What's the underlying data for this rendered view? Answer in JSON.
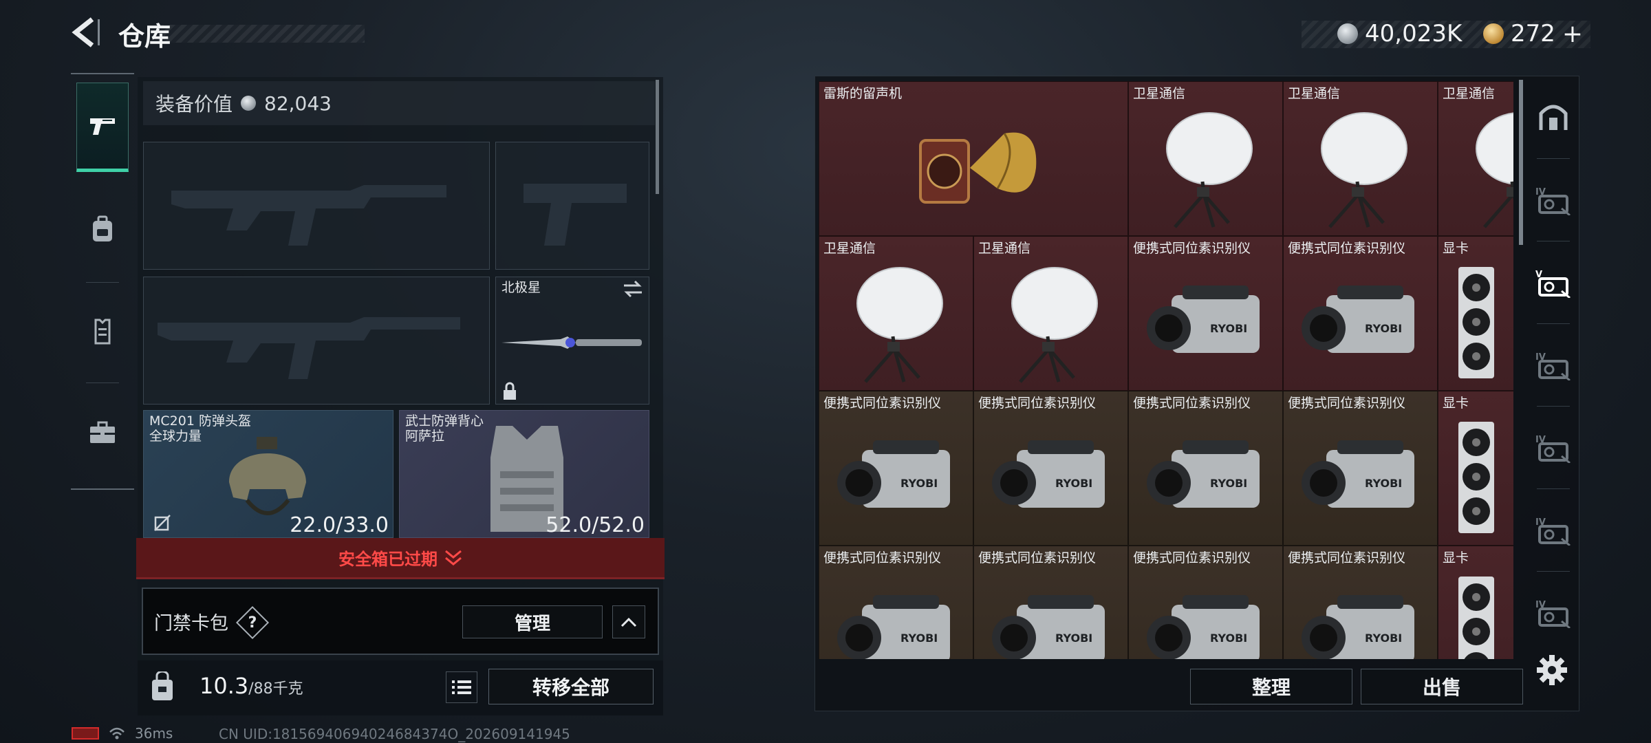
{
  "header": {
    "title": "仓库",
    "currency_silver": "40,023K",
    "currency_gold": "272",
    "currency_gold_plus": "+"
  },
  "left_tabs": [
    {
      "icon": "pistol-icon",
      "active": true
    },
    {
      "icon": "backpack-icon",
      "active": false
    },
    {
      "icon": "clipboard-icon",
      "active": false
    },
    {
      "icon": "toolbox-icon",
      "active": false
    }
  ],
  "equipment": {
    "value_label": "装备价值",
    "value": "82,043",
    "melee_name": "北极星",
    "helmet_name": "MC201 防弹头盔",
    "helmet_brand": "全球力量",
    "helmet_durability": "22.0/33.0",
    "vest_name": "武士防弹背心",
    "vest_brand": "阿萨拉",
    "vest_durability": "52.0/52.0"
  },
  "safe_box": {
    "expired_text": "安全箱已过期"
  },
  "keycard": {
    "label": "门禁卡包",
    "help": "?",
    "manage_label": "管理"
  },
  "bottom": {
    "weight_current": "10.3",
    "weight_max": "/88千克",
    "transfer_all_label": "转移全部"
  },
  "status": {
    "ping": "36ms",
    "uid": "CN UID:18156940694024684374O_202609141945"
  },
  "stash": {
    "cells": [
      {
        "label": "雷斯的留声机",
        "item": "gramophone",
        "bg": "red"
      },
      {
        "label": "卫星通信",
        "item": "satellite",
        "bg": "red"
      },
      {
        "label": "卫星通信",
        "item": "satellite",
        "bg": "red"
      },
      {
        "label": "卫星通信",
        "item": "satellite",
        "bg": "red"
      },
      {
        "label": "卫星通信",
        "item": "satellite",
        "bg": "red"
      },
      {
        "label": "卫星通信",
        "item": "satellite",
        "bg": "red"
      },
      {
        "label": "便携式同位素识别仪",
        "item": "isotope",
        "bg": "red"
      },
      {
        "label": "便携式同位素识别仪",
        "item": "isotope",
        "bg": "red"
      },
      {
        "label": "显卡",
        "item": "gpu",
        "bg": "red"
      },
      {
        "label": "便携式同位素识别仪",
        "item": "isotope",
        "bg": "brown"
      },
      {
        "label": "便携式同位素识别仪",
        "item": "isotope",
        "bg": "brown"
      },
      {
        "label": "便携式同位素识别仪",
        "item": "isotope",
        "bg": "brown"
      },
      {
        "label": "便携式同位素识别仪",
        "item": "isotope",
        "bg": "brown"
      },
      {
        "label": "显卡",
        "item": "gpu",
        "bg": "red"
      },
      {
        "label": "便携式同位素识别仪",
        "item": "isotope",
        "bg": "brown"
      },
      {
        "label": "便携式同位素识别仪",
        "item": "isotope",
        "bg": "brown"
      },
      {
        "label": "便携式同位素识别仪",
        "item": "isotope",
        "bg": "brown"
      },
      {
        "label": "便携式同位素识别仪",
        "item": "isotope",
        "bg": "brown"
      },
      {
        "label": "显卡",
        "item": "gpu",
        "bg": "red"
      }
    ],
    "tidy_label": "整理",
    "sell_label": "出售",
    "isotope_brand": "RYOBI"
  },
  "right_tabs": [
    {
      "icon": "vault-icon"
    },
    {
      "icon": "storage-iv-icon",
      "tag": "IV"
    },
    {
      "icon": "storage-v-icon",
      "tag": "V",
      "active": true
    },
    {
      "icon": "storage-iv-icon",
      "tag": "IV"
    },
    {
      "icon": "storage-iv-icon",
      "tag": "IV"
    },
    {
      "icon": "storage-iv-icon",
      "tag": "IV"
    },
    {
      "icon": "storage-iv-icon",
      "tag": "IV"
    }
  ],
  "colors": {
    "accent_green": "#3fd1a7",
    "expired_red": "#ff4a48",
    "cell_red": "#4a2529",
    "cell_brown": "#3c3128"
  }
}
